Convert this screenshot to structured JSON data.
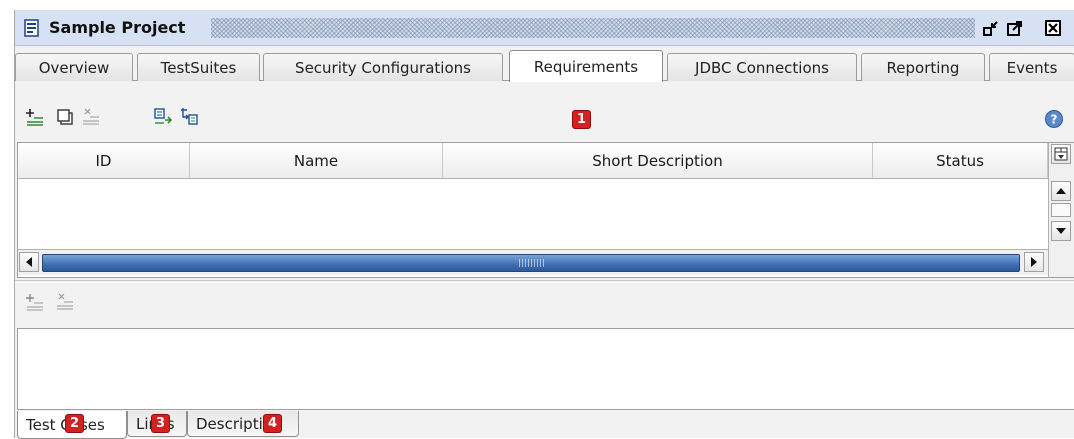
{
  "window": {
    "title": "Sample Project"
  },
  "tabs": [
    {
      "label": "Overview"
    },
    {
      "label": "TestSuites"
    },
    {
      "label": "Security Configurations"
    },
    {
      "label": "Requirements",
      "active": true
    },
    {
      "label": "JDBC Connections"
    },
    {
      "label": "Reporting"
    },
    {
      "label": "Events"
    }
  ],
  "table": {
    "columns": [
      "ID",
      "Name",
      "Short Description",
      "Status"
    ],
    "rows": []
  },
  "badges": [
    "1",
    "2",
    "3",
    "4"
  ],
  "bottom_tabs": [
    {
      "label": "Test Cases",
      "active": true
    },
    {
      "label": "Links"
    },
    {
      "label": "Description"
    }
  ],
  "colors": {
    "titlebar": "#d6e2f3",
    "badge": "#d42020",
    "scroll_thumb": "#3e6fb3"
  },
  "icons": {
    "title": "project-icon",
    "restore": "restore-icon",
    "maximize": "maximize-icon",
    "close": "close-icon",
    "add": "add-row-icon",
    "copy": "copy-icon",
    "remove": "remove-row-icon",
    "import": "import-icon",
    "export": "export-icon",
    "help": "help-icon"
  }
}
